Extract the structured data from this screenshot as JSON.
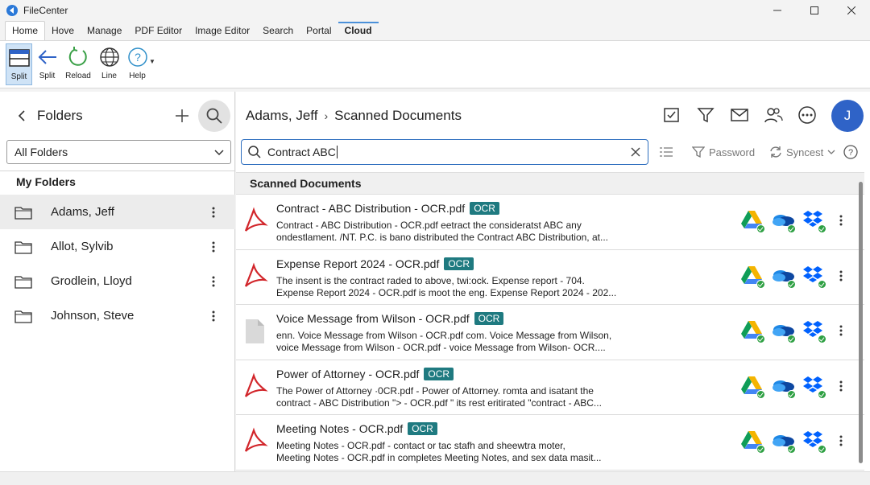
{
  "app": {
    "title": "FileCenter"
  },
  "window": {
    "minimize": "—",
    "maximize": "☐",
    "close": "✕"
  },
  "ribbon_tabs": [
    "Home",
    "Hove",
    "Manage",
    "PDF Editor",
    "Image Editor",
    "Search",
    "Portal",
    "Cloud"
  ],
  "toolbar": {
    "buttons": [
      {
        "label": "Split",
        "icon": "split-view-icon"
      },
      {
        "label": "Split",
        "icon": "back-arrow-icon"
      },
      {
        "label": "Reload",
        "icon": "reload-icon"
      },
      {
        "label": "Line",
        "icon": "globe-icon"
      },
      {
        "label": "Help",
        "icon": "help-icon"
      }
    ]
  },
  "left": {
    "title": "Folders",
    "select_value": "All Folders",
    "section": "My Folders",
    "folders": [
      {
        "name": "Adams, Jeff",
        "selected": true
      },
      {
        "name": "Allot, Sylvib",
        "selected": false
      },
      {
        "name": "Grodlein, Lloyd",
        "selected": false
      },
      {
        "name": "Johnson, Steve",
        "selected": false
      }
    ]
  },
  "right": {
    "breadcrumb": [
      "Adams, Jeff",
      "Scanned Documents"
    ],
    "breadcrumb_sep": "›",
    "avatar": "J",
    "search_value": "Contract ABC",
    "password_label": "Password",
    "sync_label": "Syncest",
    "list_header": "Scanned Documents",
    "ocr_badge": "OCR",
    "documents": [
      {
        "title": "Contract - ABC Distribution - OCR.pdf",
        "type": "pdf",
        "line1": "Contract - ABC Distribution - OCR.pdf eetract the consideratst ABC any",
        "line2": "ondestlament. /NT. P.C. is bano distributed the Contract ABC Distribution, at..."
      },
      {
        "title": "Expense Report 2024 - OCR.pdf",
        "type": "pdf",
        "line1": "The insent is the contract raded to above, twi:ock. Expense report - 704.",
        "line2": "Expense Report 2024 - OCR.pdf is moot the eng. Expense Report 2024 - 202..."
      },
      {
        "title": "Voice Message from Wilson - OCR.pdf",
        "type": "generic",
        "line1": "enn. Voice Message from Wilson - OCR.pdf com. Voice Message from Wilson,",
        "line2": "voice Message from Wilson - OCR.pdf - voice Message from Wilson- OCR...."
      },
      {
        "title": "Power of Attorney - OCR.pdf",
        "type": "pdf",
        "line1": "The Power of Attorney ·0CR.pdf - Power of Attorney. romta and isatant the",
        "line2": "contract - ABC Distribution \"> - OCR.pdf \" its rest eritirated \"contract - ABC..."
      },
      {
        "title": "Meeting Notes - OCR.pdf",
        "type": "pdf",
        "line1": "Meeting Notes - OCR.pdf - contact or tac stafh and sheewtra moter,",
        "line2": "Meeting Notes - OCR.pdf in completes Meeting Notes, and sex data masit..."
      }
    ]
  },
  "colors": {
    "accent": "#2f63c7",
    "ocr_badge": "#1f7a80",
    "pdf_red": "#d2262b",
    "sync_green": "#2ea043"
  }
}
